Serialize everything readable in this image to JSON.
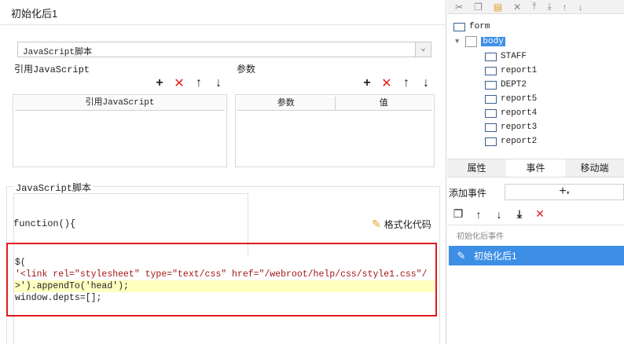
{
  "dialog": {
    "title": "初始化后1",
    "script_type": "JavaScript脚本",
    "ref_js_label": "引用JavaScript",
    "params_label": "参数",
    "ref_js_column": "引用JavaScript",
    "param_columns": [
      "参数",
      "值"
    ],
    "script_section_label": "JavaScript脚本",
    "function_header": "function(){",
    "format_code_label": "格式化代码",
    "code_lines": [
      "$(",
      "'<link rel=\"stylesheet\" type=\"text/css\" href=\"/webroot/help/css/style1.css\"/",
      ">').appendTo('head');",
      "window.depts=[];"
    ]
  },
  "toolbar_icons": [
    "add-icon",
    "delete-icon",
    "move-up-icon",
    "move-down-icon"
  ],
  "right_panel": {
    "tree": {
      "root": "form",
      "body": "body",
      "children": [
        "STAFF",
        "report1",
        "DEPT2",
        "report5",
        "report4",
        "report3",
        "report2"
      ]
    },
    "tabs": [
      "属性",
      "事件",
      "移动端"
    ],
    "active_tab": "事件",
    "add_event_label": "添加事件",
    "add_event_button": "+",
    "event_group": "初始化后事件",
    "event_item": "初始化后1"
  },
  "colors": {
    "accent": "#3d8fe6",
    "delete_red": "#e02020",
    "highlight_frame": "#e21b1b",
    "code_highlight": "#ffffc0"
  }
}
